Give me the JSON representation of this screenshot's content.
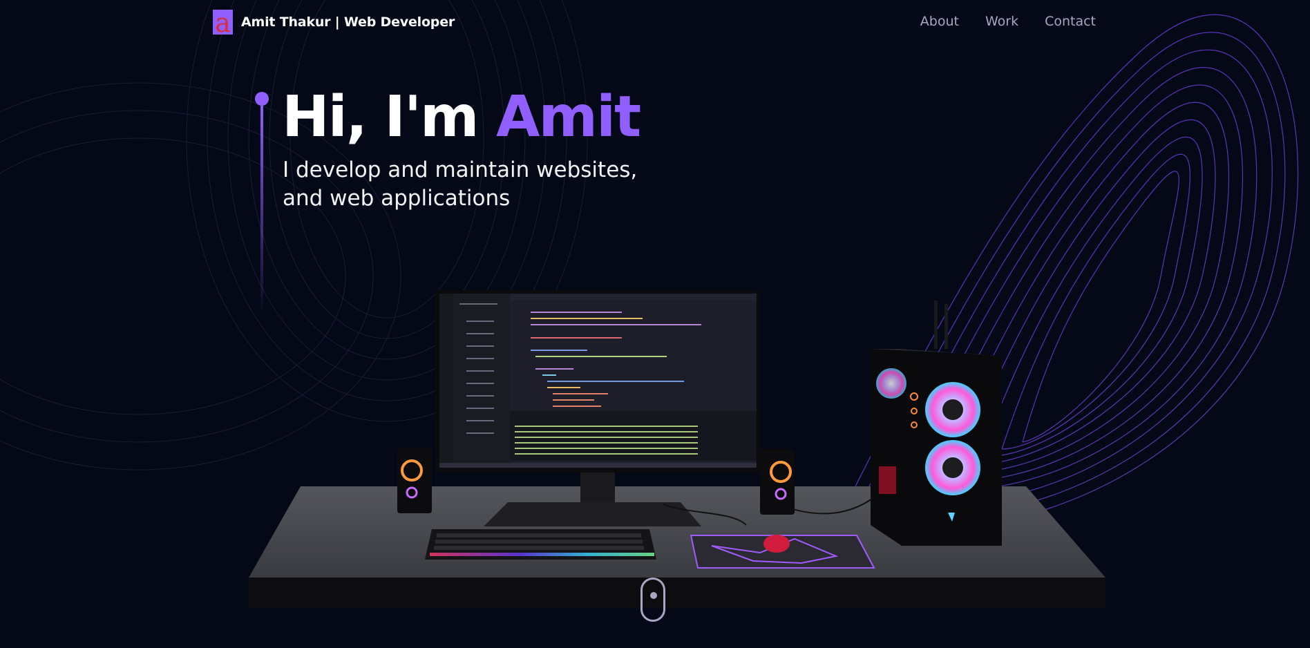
{
  "nav": {
    "logo_letter": "a",
    "brand": "Amit Thakur | Web Developer",
    "links": [
      "About",
      "Work",
      "Contact"
    ]
  },
  "hero": {
    "greeting": "Hi, I'm ",
    "name": "Amit",
    "subtitle": "I develop and maintain websites, and web applications"
  },
  "colors": {
    "background": "#050816",
    "accent": "#915eff",
    "nav_text": "#aaa6c3"
  },
  "icons": [
    "logo-icon",
    "scroll-indicator-icon"
  ]
}
